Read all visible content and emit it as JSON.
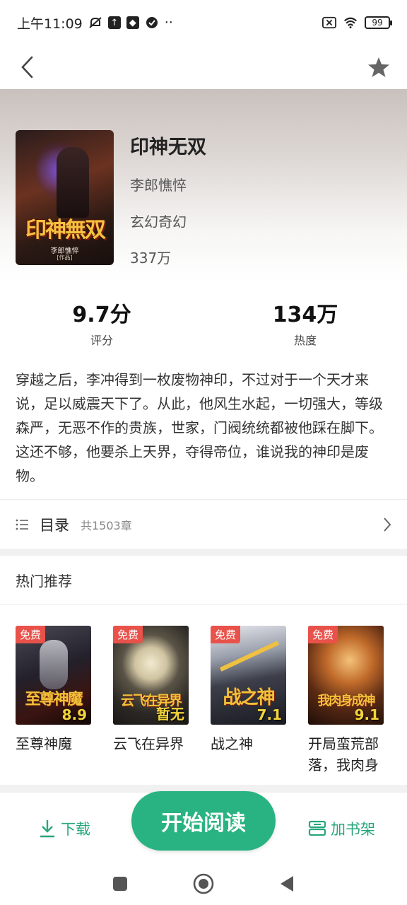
{
  "status_bar": {
    "time": "上午11:09",
    "battery": "99"
  },
  "book": {
    "title": "印神无双",
    "author": "李郎憔悴",
    "genre": "玄幻奇幻",
    "words": "337万",
    "cover": {
      "title_art": "印神無双",
      "author_art": "李郎憔悴",
      "tag_art": "[作品]"
    }
  },
  "stats": {
    "rating_value": "9.7分",
    "rating_label": "评分",
    "heat_value": "134万",
    "heat_label": "热度"
  },
  "synopsis": "穿越之后，李冲得到一枚废物神印，不过对于一个天才来说，足以威震天下了。从此，他风生水起，一切强大，等级森严，无恶不作的贵族，世家，门阀统统都被他踩在脚下。这还不够，他要杀上天界，夺得帝位，谁说我的神印是废物。",
  "catalog": {
    "label": "目录",
    "count": "共1503章"
  },
  "recommendations": {
    "heading": "热门推荐",
    "items": [
      {
        "free": "免费",
        "score": "8.9",
        "name": "至尊神魔",
        "cover_text": "至尊神魔"
      },
      {
        "free": "免费",
        "score": "暂无",
        "name": "云飞在异界",
        "cover_text": "云飞在异界"
      },
      {
        "free": "免费",
        "score": "7.1",
        "name": "战之神",
        "cover_text": "战之神"
      },
      {
        "free": "免费",
        "score": "9.1",
        "name": "开局蛮荒部落，我肉身",
        "cover_text": "我肉身成神"
      }
    ]
  },
  "bottom_bar": {
    "download": "下载",
    "start_reading": "开始阅读",
    "add_shelf": "加书架"
  },
  "colors": {
    "accent": "#29b382",
    "accent_text": "#27a67c",
    "free_badge": "#e8524a"
  }
}
